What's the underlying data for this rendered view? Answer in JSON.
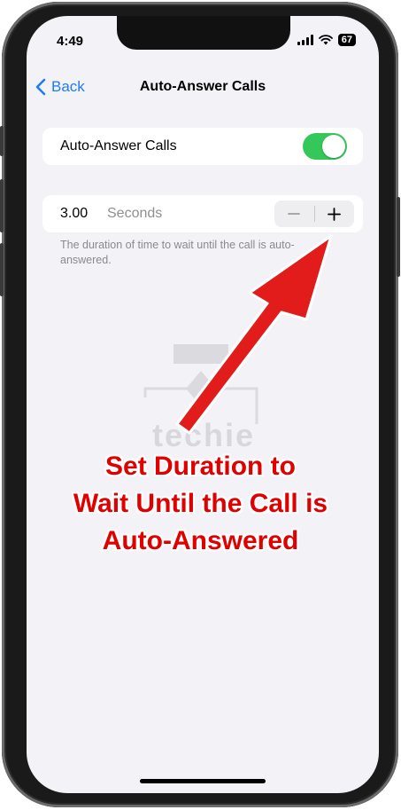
{
  "status_bar": {
    "time": "4:49",
    "battery": "67"
  },
  "nav": {
    "back_label": "Back",
    "title": "Auto-Answer Calls"
  },
  "toggle_row": {
    "label": "Auto-Answer Calls",
    "enabled": true
  },
  "duration_row": {
    "value": "3.00",
    "unit": "Seconds",
    "decrement": "−",
    "increment": "+"
  },
  "footer_note": "The duration of time to wait until the call is auto-answered.",
  "watermark": "techie",
  "annotation": {
    "lines": [
      "Set Duration to",
      "Wait Until the Call is",
      "Auto-Answered"
    ]
  },
  "colors": {
    "accent": "#1f7cf2",
    "switch_on": "#34c759",
    "annotation": "#e00000",
    "background": "#f2f2f7"
  }
}
